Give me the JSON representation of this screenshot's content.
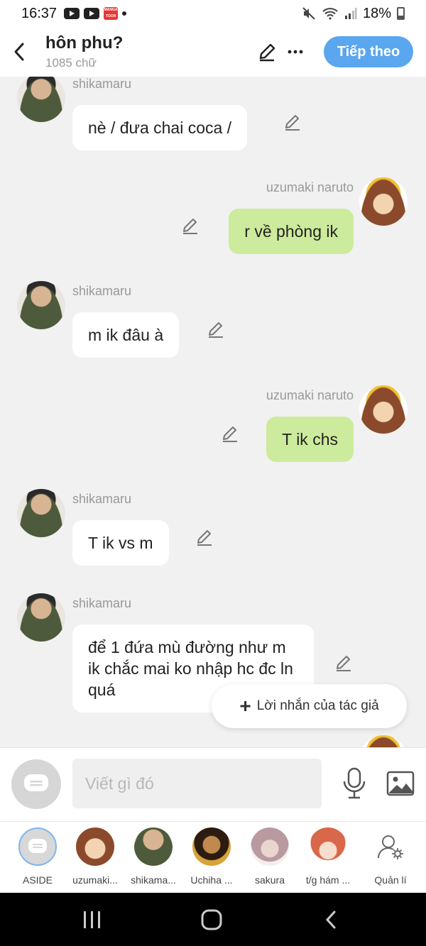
{
  "status_bar": {
    "time": "16:37",
    "battery": "18%"
  },
  "header": {
    "title": "hôn phu?",
    "subtitle": "1085 chữ",
    "next_label": "Tiếp theo"
  },
  "messages": [
    {
      "sender": "shikamaru",
      "text": "nè / đưa chai coca /",
      "side": "left"
    },
    {
      "sender": "uzumaki naruto",
      "text": "r về phòng ik",
      "side": "right"
    },
    {
      "sender": "shikamaru",
      "text": "m ik đâu à",
      "side": "left"
    },
    {
      "sender": "uzumaki naruto",
      "text": "T ik chs",
      "side": "right"
    },
    {
      "sender": "shikamaru",
      "text": "T ik vs m",
      "side": "left"
    },
    {
      "sender": "shikamaru",
      "text": "để 1 đứa mù đường như m ik chắc mai ko nhập hc đc ln quá",
      "side": "left"
    }
  ],
  "author_note_label": "Lời nhắn của tác giả",
  "compose": {
    "placeholder": "Viết gì đó"
  },
  "characters": [
    {
      "label": "ASIDE"
    },
    {
      "label": "uzumaki..."
    },
    {
      "label": "shikama..."
    },
    {
      "label": "Uchiha ..."
    },
    {
      "label": "sakura"
    },
    {
      "label": "t/g hám ..."
    },
    {
      "label": "Quản lí"
    }
  ],
  "icons": {
    "back": "chevron-left-icon",
    "edit": "pencil-icon",
    "more": "more-horizontal-icon",
    "mic": "microphone-icon",
    "image": "image-icon",
    "manage": "user-settings-icon"
  },
  "colors": {
    "accent": "#5aa6ef",
    "right_bubble": "#cdeb9c",
    "left_bubble": "#ffffff",
    "chat_bg": "#f1f1f1"
  }
}
